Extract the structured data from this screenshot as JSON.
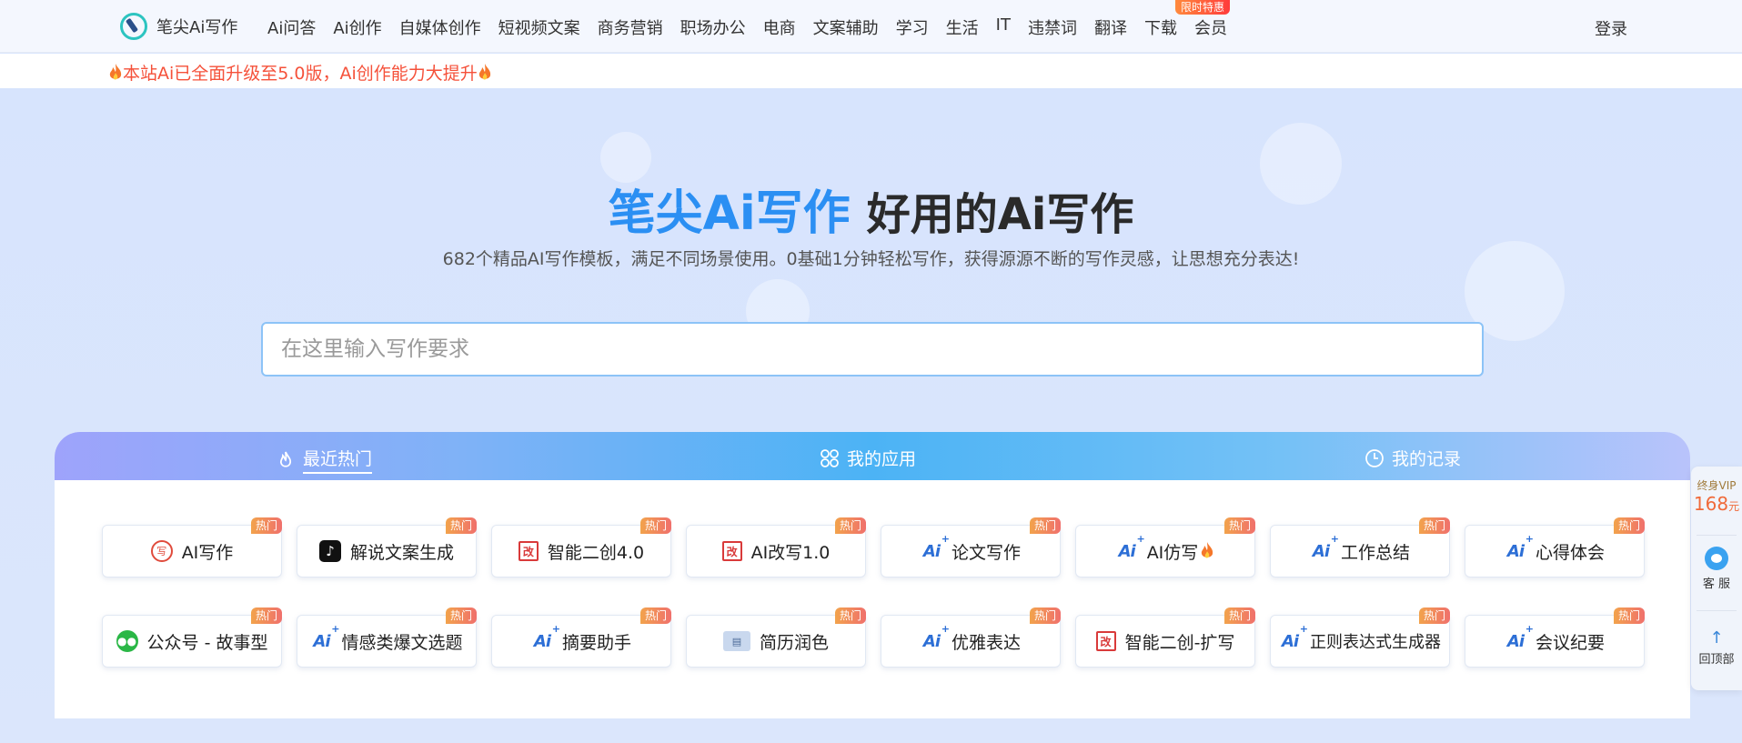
{
  "header": {
    "logo_text": "笔尖Ai写作",
    "nav": [
      "Ai问答",
      "Ai创作",
      "自媒体创作",
      "短视频文案",
      "商务营销",
      "职场办公",
      "电商",
      "文案辅助",
      "学习",
      "生活",
      "IT",
      "违禁词",
      "翻译",
      "下载",
      "会员"
    ],
    "promo_badge": "限时特惠",
    "login": "登录"
  },
  "notice": {
    "text": "本站Ai已全面升级至5.0版，Ai创作能力大提升"
  },
  "hero": {
    "title_brand": "笔尖Ai写作",
    "title_rest": "好用的Ai写作",
    "subtitle": "682个精品AI写作模板，满足不同场景使用。0基础1分钟轻松写作，获得源源不断的写作灵感，让思想充分表达!",
    "search_placeholder": "在这里输入写作要求"
  },
  "tabs": [
    {
      "label": "最近热门",
      "icon": "flame-icon",
      "active": true
    },
    {
      "label": "我的应用",
      "icon": "apps-grid-icon",
      "active": false
    },
    {
      "label": "我的记录",
      "icon": "clock-icon",
      "active": false
    }
  ],
  "hot_label": "热门",
  "cards": [
    {
      "label": "AI写作",
      "icon": "write-icon"
    },
    {
      "label": "解说文案生成",
      "icon": "tiktok-icon"
    },
    {
      "label": "智能二创4.0",
      "icon": "rewrite-icon"
    },
    {
      "label": "AI改写1.0",
      "icon": "rewrite-icon"
    },
    {
      "label": "论文写作",
      "icon": "ai-icon"
    },
    {
      "label": "AI仿写",
      "icon": "ai-icon",
      "flame": true
    },
    {
      "label": "工作总结",
      "icon": "ai-icon"
    },
    {
      "label": "心得体会",
      "icon": "ai-icon"
    },
    {
      "label": "公众号 - 故事型",
      "icon": "wechat-icon"
    },
    {
      "label": "情感类爆文选题",
      "icon": "ai-icon"
    },
    {
      "label": "摘要助手",
      "icon": "ai-icon"
    },
    {
      "label": "简历润色",
      "icon": "resume-icon"
    },
    {
      "label": "优雅表达",
      "icon": "ai-icon"
    },
    {
      "label": "智能二创-扩写",
      "icon": "rewrite-icon"
    },
    {
      "label": "正则表达式生成器",
      "icon": "ai-icon"
    },
    {
      "label": "会议纪要",
      "icon": "ai-icon"
    }
  ],
  "sidebar": {
    "vip_label": "终身VIP",
    "vip_price": "168",
    "vip_unit": "元",
    "service": "客 服",
    "back_top": "回顶部"
  },
  "colors": {
    "brand": "#2b8ff3",
    "notice": "#f5513a",
    "hot_badge": "#f0706c"
  }
}
